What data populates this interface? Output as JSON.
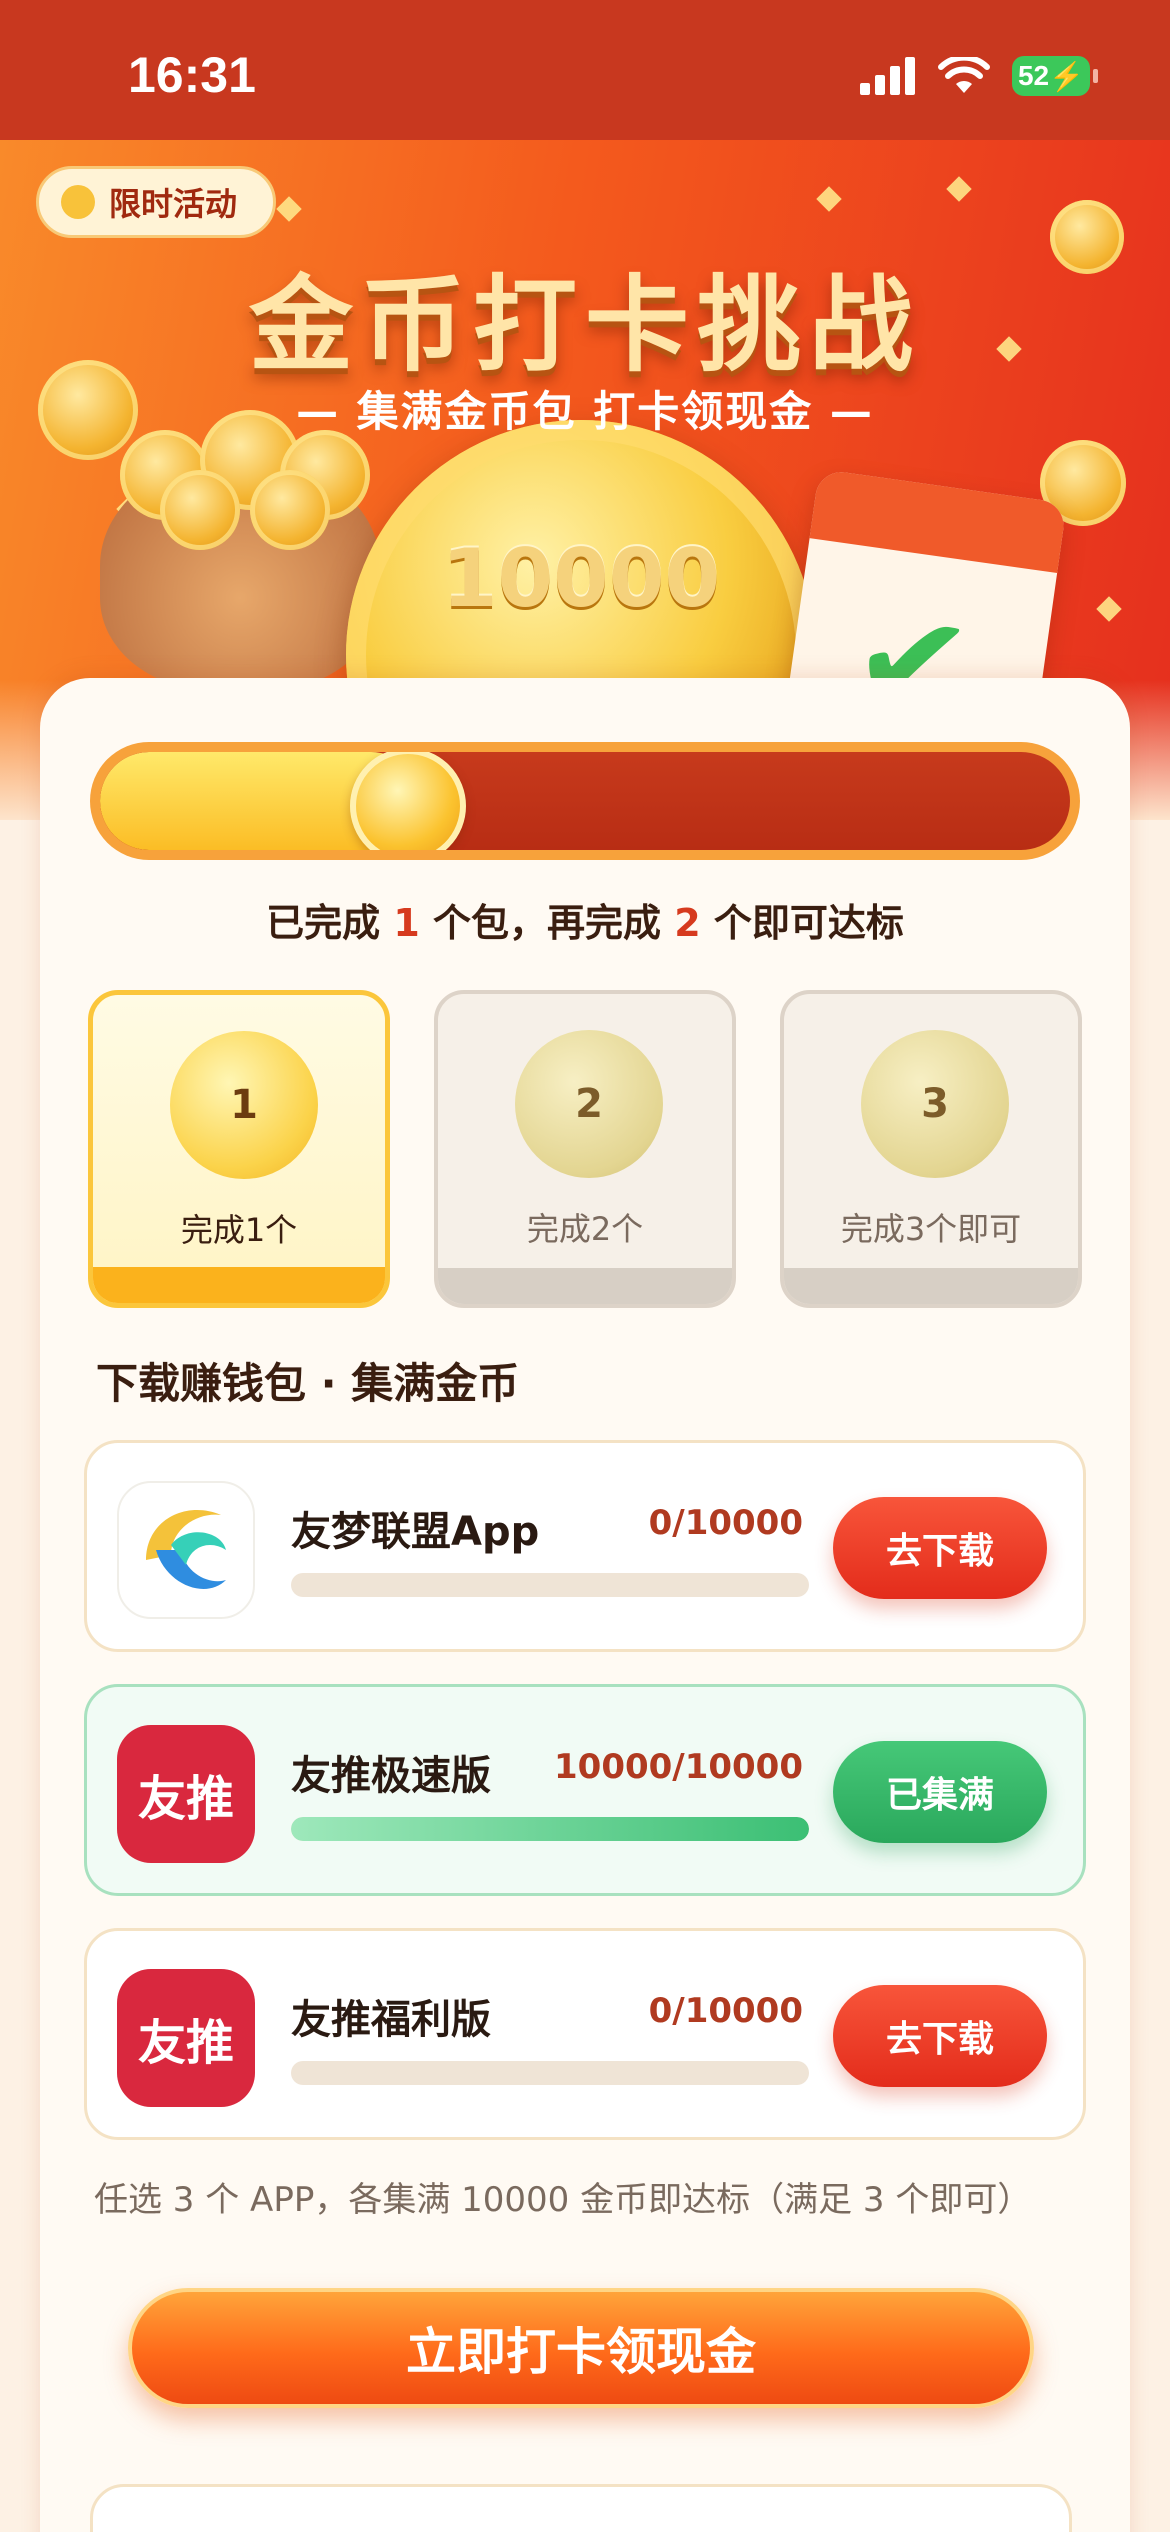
{
  "status_bar": {
    "time": "16:31",
    "battery": "52"
  },
  "hero": {
    "badge": "限时活动",
    "title": "金币打卡挑战",
    "subtitle": "— 集满金币包 打卡领现金 —",
    "coin_value": "10000"
  },
  "progress": {
    "fraction": 0.33,
    "text_prefix": "已完成 ",
    "completed": "1",
    "text_mid": " 个包，再完成 ",
    "remaining": "2",
    "text_suffix": " 个即可达标"
  },
  "milestones": [
    {
      "number": "1",
      "label": "完成1个",
      "active": true
    },
    {
      "number": "2",
      "label": "完成2个",
      "active": false
    },
    {
      "number": "3",
      "label": "完成3个即可",
      "active": false
    }
  ],
  "section_title": "下载赚钱包 · 集满金币",
  "apps": [
    {
      "name": "友梦联盟App",
      "icon_text": "",
      "icon": "youmeng-logo-icon",
      "count": "0/10000",
      "fill": 0,
      "button": "去下载",
      "done": false
    },
    {
      "name": "友推极速版",
      "icon_text": "友推",
      "icon": "youtui-icon",
      "count": "10000/10000",
      "fill": 1,
      "button": "已集满",
      "done": true
    },
    {
      "name": "友推福利版",
      "icon_text": "友推",
      "icon": "youtui-icon",
      "count": "0/10000",
      "fill": 0,
      "button": "去下载",
      "done": false
    }
  ],
  "rule_text": "任选 3 个 APP，各集满 10000 金币即达标（满足 3 个即可）",
  "cta_label": "立即打卡领现金",
  "colors": {
    "brand_red": "#e32c1b",
    "gold": "#fbc63b",
    "success_green": "#2aa85c",
    "page_bg": "#fdf1e4"
  }
}
